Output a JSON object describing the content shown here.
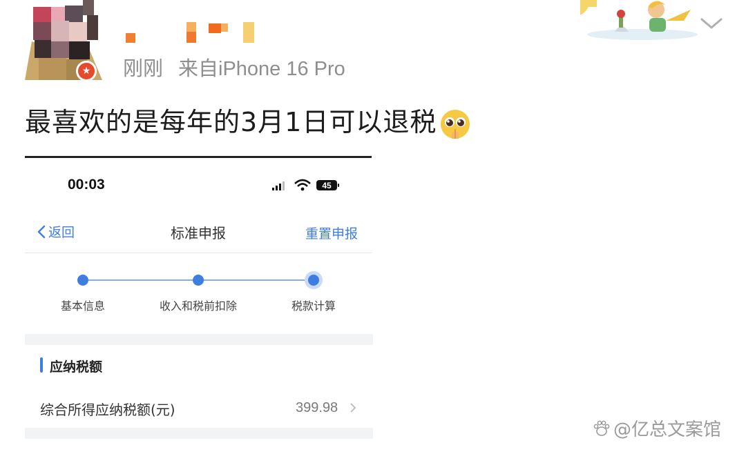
{
  "post": {
    "time": "刚刚",
    "source": "来自iPhone 16 Pro",
    "text": "最喜欢的是每年的3月1日可以退税"
  },
  "screenshot": {
    "status_time": "00:03",
    "battery": "45",
    "nav": {
      "back_label": "返回",
      "title": "标准申报",
      "right_action": "重置申报"
    },
    "steps": [
      "基本信息",
      "收入和税前扣除",
      "税款计算"
    ],
    "section_title": "应纳税额",
    "row": {
      "label": "综合所得应纳税额(元)",
      "value": "399.98"
    },
    "colors": {
      "accent": "#3f7de0",
      "band": "#f2f3f5"
    }
  },
  "watermark": "@亿总文案馆"
}
